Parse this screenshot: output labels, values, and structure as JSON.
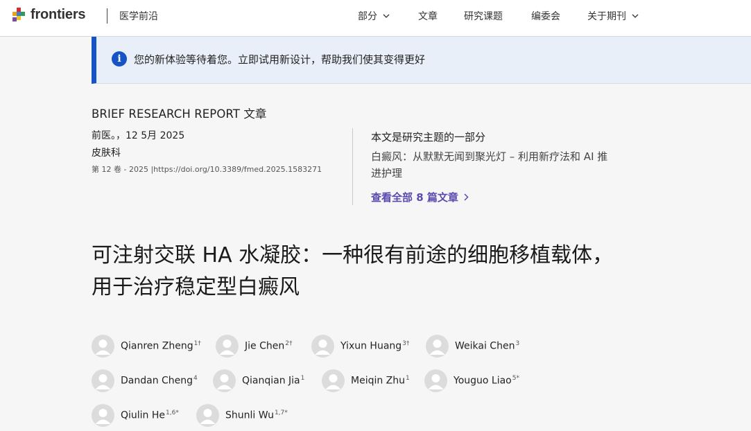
{
  "header": {
    "logo_text": "frontiers",
    "journal": "医学前沿",
    "nav": [
      {
        "label": "部分",
        "dropdown": true
      },
      {
        "label": "文章",
        "dropdown": false
      },
      {
        "label": "研究课题",
        "dropdown": false
      },
      {
        "label": "编委会",
        "dropdown": false
      },
      {
        "label": "关于期刊",
        "dropdown": true
      }
    ]
  },
  "banner": {
    "icon": "info-icon",
    "text": "您的新体验等待着您。立即试用新设计，帮助我们使其变得更好"
  },
  "article": {
    "type": "BRIEF RESEARCH REPORT 文章",
    "journal_date": "前医。，12 5月 2025",
    "section": "皮肤科",
    "volume": "第 12 卷 - 2025",
    "doi": "https://doi.org/10.3389/fmed.2025.1583271",
    "title": "可注射交联 HA 水凝胶：一种很有前途的细胞移植载体，用于治疗稳定型白癜风"
  },
  "topic": {
    "heading": "本文是研究主题的一部分",
    "title": "白癜风：从默默无闻到聚光灯 – 利用新疗法和 AI 推进护理",
    "link": "查看全部 8 篇文章"
  },
  "authors": [
    {
      "name": "Qianren Zheng",
      "aff": "1†"
    },
    {
      "name": "Jie Chen",
      "aff": "2†"
    },
    {
      "name": "Yixun Huang",
      "aff": "3†"
    },
    {
      "name": "Weikai Chen",
      "aff": "3"
    },
    {
      "name": "Dandan Cheng",
      "aff": "4"
    },
    {
      "name": "Qianqian Jia",
      "aff": "1"
    },
    {
      "name": "Meiqin Zhu",
      "aff": "1"
    },
    {
      "name": "Youguo Liao",
      "aff": "5*"
    },
    {
      "name": "Qiulin He",
      "aff": "1,6*"
    },
    {
      "name": "Shunli Wu",
      "aff": "1,7*"
    }
  ],
  "colors": {
    "accent_blue": "#1653c4",
    "link_purple": "#5a4ab0",
    "banner_bg": "#e9eff8"
  }
}
